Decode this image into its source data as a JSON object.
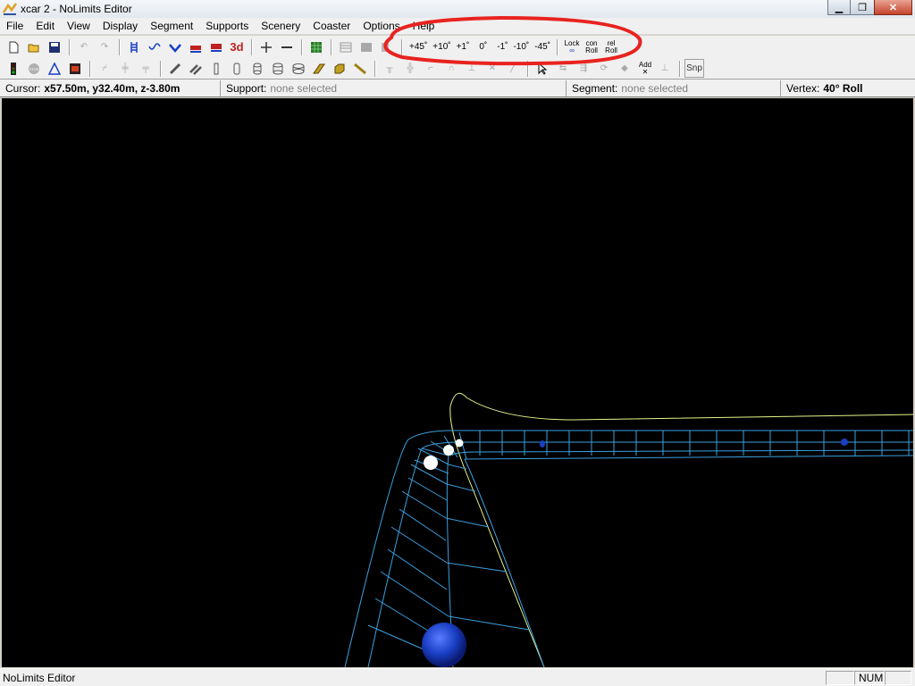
{
  "window": {
    "title": "xcar 2 - NoLimits Editor",
    "minimize": "▁",
    "restore": "❐",
    "close": "✕"
  },
  "menu": [
    "File",
    "Edit",
    "View",
    "Display",
    "Segment",
    "Supports",
    "Scenery",
    "Coaster",
    "Options",
    "Help"
  ],
  "toolbar1": {
    "file_icons": [
      "new-file-icon",
      "open-folder-icon",
      "save-disk-icon"
    ],
    "edit_icons": [
      "undo-icon",
      "redo-icon"
    ],
    "segment_icons": [
      "track-ladder-icon",
      "track-curve-icon",
      "track-dip-icon",
      "coaster-train-icon",
      "coaster-train-2-icon"
    ],
    "label_3d": "3d",
    "roll_buttons": [
      "+45˚",
      "+10˚",
      "+1˚",
      "0˚",
      "-1˚",
      "-10˚",
      "-45˚"
    ],
    "lock_label_top": "Lock",
    "lock_label_bottom": "∞",
    "con_roll_top": "con",
    "con_roll_bottom": "Roll",
    "rel_roll_top": "rel",
    "rel_roll_bottom": "Roll"
  },
  "toolbar2": {
    "add_label_top": "Add",
    "add_label_bottom": "✕",
    "snap_label": "Snp"
  },
  "status": {
    "cursor_label": "Cursor:",
    "cursor_value": "x57.50m, y32.40m, z-3.80m",
    "support_label": "Support:",
    "support_value": "none selected",
    "segment_label": "Segment:",
    "segment_value": "none selected",
    "vertex_label": "Vertex:",
    "vertex_value": "40° Roll"
  },
  "footer": {
    "app_name": "NoLimits Editor",
    "num_indicator": "NUM"
  },
  "colors": {
    "track": "#3aa0e0",
    "spine": "#e6f58a",
    "annotation": "#e8231f",
    "vertex_handle": "#1a3fc4"
  }
}
